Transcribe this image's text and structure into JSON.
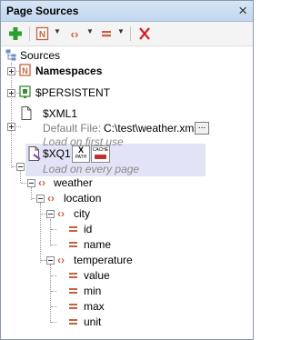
{
  "window": {
    "title": "Page Sources"
  },
  "toolbar": {
    "add_icon": "plus-icon",
    "namespace_icon": "namespace-icon",
    "element_icon": "element-icon",
    "equals_icon": "equals-icon",
    "remove_icon": "x-icon"
  },
  "tree": {
    "root_label": "Sources",
    "namespaces_label": "Namespaces",
    "persistent_label": "$PERSISTENT",
    "xml1": {
      "label": "$XML1",
      "default_file_label": "Default File:",
      "default_file_value": "C:\\test\\weather.xml",
      "browse_label": "...",
      "load_note": "Load on first use"
    },
    "xq1": {
      "label": "$XQ1",
      "xpath_badge_top": "X",
      "xpath_badge_bottom": "PATH",
      "cache_badge": "CACHE",
      "load_note": "Load on every page"
    },
    "nodes": {
      "weather": "weather",
      "location": "location",
      "city": "city",
      "id": "id",
      "name": "name",
      "temperature": "temperature",
      "value": "value",
      "min": "min",
      "max": "max",
      "unit": "unit"
    }
  },
  "colors": {
    "add_green": "#2e9e2e",
    "element_orange": "#c4623f",
    "remove_red": "#d42020",
    "selection": "#e3e3f7"
  }
}
